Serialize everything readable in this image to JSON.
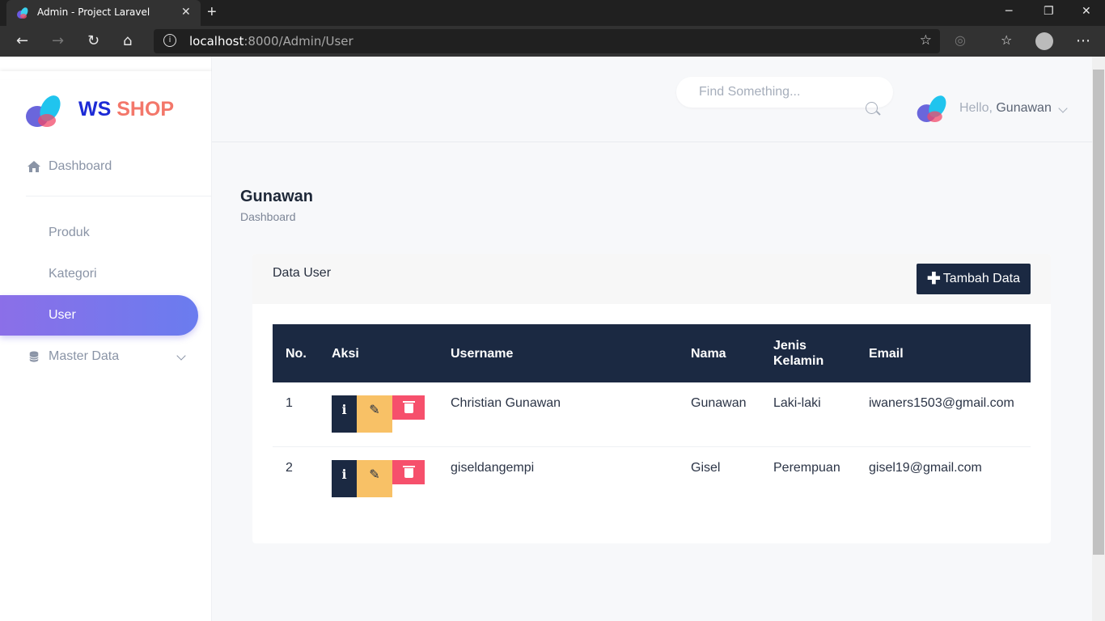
{
  "browser": {
    "tab_title": "Admin - Project Laravel",
    "url_host": "localhost",
    "url_path": ":8000/Admin/User"
  },
  "brand": {
    "part1": "WS",
    "part2": "SHOP"
  },
  "sidebar": {
    "items": [
      {
        "label": "Dashboard",
        "icon": "home-icon"
      },
      {
        "label": "Produk",
        "icon": "grid-icon"
      },
      {
        "label": "Kategori",
        "icon": "grid-icon"
      },
      {
        "label": "User",
        "icon": "grid-icon",
        "active": true
      },
      {
        "label": "Master Data",
        "icon": "database-icon"
      }
    ]
  },
  "header": {
    "search_placeholder": "Find Something...",
    "hello": "Hello,",
    "username": "Gunawan"
  },
  "page": {
    "title": "Gunawan",
    "breadcrumb": "Dashboard"
  },
  "card": {
    "title": "Data User",
    "add_button": "Tambah Data"
  },
  "table": {
    "headers": [
      "No.",
      "Aksi",
      "Username",
      "Nama",
      "Jenis Kelamin",
      "Email"
    ],
    "rows": [
      {
        "no": "1",
        "username": "Christian Gunawan",
        "nama": "Gunawan",
        "jenis_kelamin": "Laki-laki",
        "email": "iwaners1503@gmail.com"
      },
      {
        "no": "2",
        "username": "giseldangempi",
        "nama": "Gisel",
        "jenis_kelamin": "Perempuan",
        "email": "gisel19@gmail.com"
      }
    ]
  },
  "colors": {
    "primary_dark": "#1b2942",
    "accent_gradient_start": "#8b6fe8",
    "accent_gradient_end": "#6a7cef",
    "edit": "#f8c166",
    "delete": "#f6506c",
    "brand_ws": "#1d2bd6",
    "brand_shop": "#f3776a"
  }
}
